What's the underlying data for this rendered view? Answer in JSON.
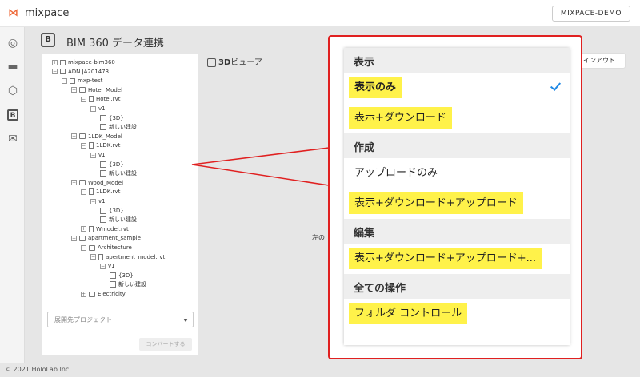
{
  "app": {
    "title": "mixpace",
    "logo": "mixpace-logo"
  },
  "header": {
    "account_button": "MIXPACE-DEMO"
  },
  "sidebar": {
    "items": [
      {
        "name": "globe-icon",
        "glyph": "◎"
      },
      {
        "name": "folder-icon",
        "glyph": "▬"
      },
      {
        "name": "cube-icon",
        "glyph": "⬡"
      },
      {
        "name": "bim-icon",
        "glyph": "B"
      },
      {
        "name": "mail-icon",
        "glyph": "✉"
      }
    ],
    "expand_glyph": "»"
  },
  "page": {
    "badge": "B",
    "title": "BIM 360 データ連携"
  },
  "tree": {
    "nodes": [
      {
        "label": "mixpace-bim360",
        "toggle": "+",
        "icon": "proj"
      },
      {
        "label": "ADN JA201473",
        "toggle": "−",
        "icon": "proj"
      },
      {
        "label": "mxp-test",
        "toggle": "−",
        "icon": "hub"
      },
      {
        "label": "Hotel_Model",
        "toggle": "−",
        "icon": "folder"
      },
      {
        "label": "Hotel.rvt",
        "toggle": "−",
        "icon": "file"
      },
      {
        "label": "v1",
        "toggle": "−",
        "icon": "none"
      },
      {
        "label": "{3D}",
        "toggle": "",
        "icon": "box"
      },
      {
        "label": "新しい建設",
        "toggle": "",
        "icon": "box"
      },
      {
        "label": "1LDK_Model",
        "toggle": "−",
        "icon": "folder"
      },
      {
        "label": "1LDK.rvt",
        "toggle": "−",
        "icon": "file"
      },
      {
        "label": "v1",
        "toggle": "−",
        "icon": "none"
      },
      {
        "label": "{3D}",
        "toggle": "",
        "icon": "box"
      },
      {
        "label": "新しい建設",
        "toggle": "",
        "icon": "box"
      },
      {
        "label": "Wood_Model",
        "toggle": "−",
        "icon": "folder"
      },
      {
        "label": "1LDK.rvt",
        "toggle": "−",
        "icon": "file"
      },
      {
        "label": "v1",
        "toggle": "−",
        "icon": "none"
      },
      {
        "label": "{3D}",
        "toggle": "",
        "icon": "box"
      },
      {
        "label": "新しい建設",
        "toggle": "",
        "icon": "box"
      },
      {
        "label": "Wmodel.rvt",
        "toggle": "+",
        "icon": "file"
      },
      {
        "label": "apartment_sample",
        "toggle": "−",
        "icon": "folder"
      },
      {
        "label": "Architecture",
        "toggle": "−",
        "icon": "folder"
      },
      {
        "label": "apertment_model.rvt",
        "toggle": "−",
        "icon": "file"
      },
      {
        "label": "v1",
        "toggle": "−",
        "icon": "none"
      },
      {
        "label": "{3D}",
        "toggle": "",
        "icon": "box"
      },
      {
        "label": "新しい建設",
        "toggle": "",
        "icon": "box"
      },
      {
        "label": "Electricity",
        "toggle": "+",
        "icon": "folder"
      }
    ]
  },
  "project_select": {
    "placeholder": "展開先プロジェクト"
  },
  "convert_button": "コンバートする",
  "viewer": {
    "prefix": "3D",
    "label": "ビューア"
  },
  "left_note": "左の",
  "signout_button": "インアウト",
  "menu": {
    "groups": [
      {
        "label": "表示",
        "items": [
          {
            "label": "表示のみ",
            "highlighted": true,
            "selected": true
          },
          {
            "label": "表示+ダウンロード",
            "highlighted": true,
            "selected": false
          }
        ]
      },
      {
        "label": "作成",
        "items": [
          {
            "label": "アップロードのみ",
            "highlighted": false,
            "selected": false
          },
          {
            "label": "表示+ダウンロード+アップロード",
            "highlighted": true,
            "selected": false
          }
        ]
      },
      {
        "label": "編集",
        "items": [
          {
            "label": "表示+ダウンロード+アップロード+...",
            "highlighted": true,
            "selected": false
          }
        ]
      },
      {
        "label": "全ての操作",
        "items": [
          {
            "label": "フォルダ コントロール",
            "highlighted": true,
            "selected": false
          }
        ]
      }
    ]
  },
  "colors": {
    "highlight": "#fff24a",
    "callout": "#e02020",
    "check": "#1e88e5",
    "brand": "#ee6a3a"
  },
  "footer": "© 2021 HoloLab Inc."
}
